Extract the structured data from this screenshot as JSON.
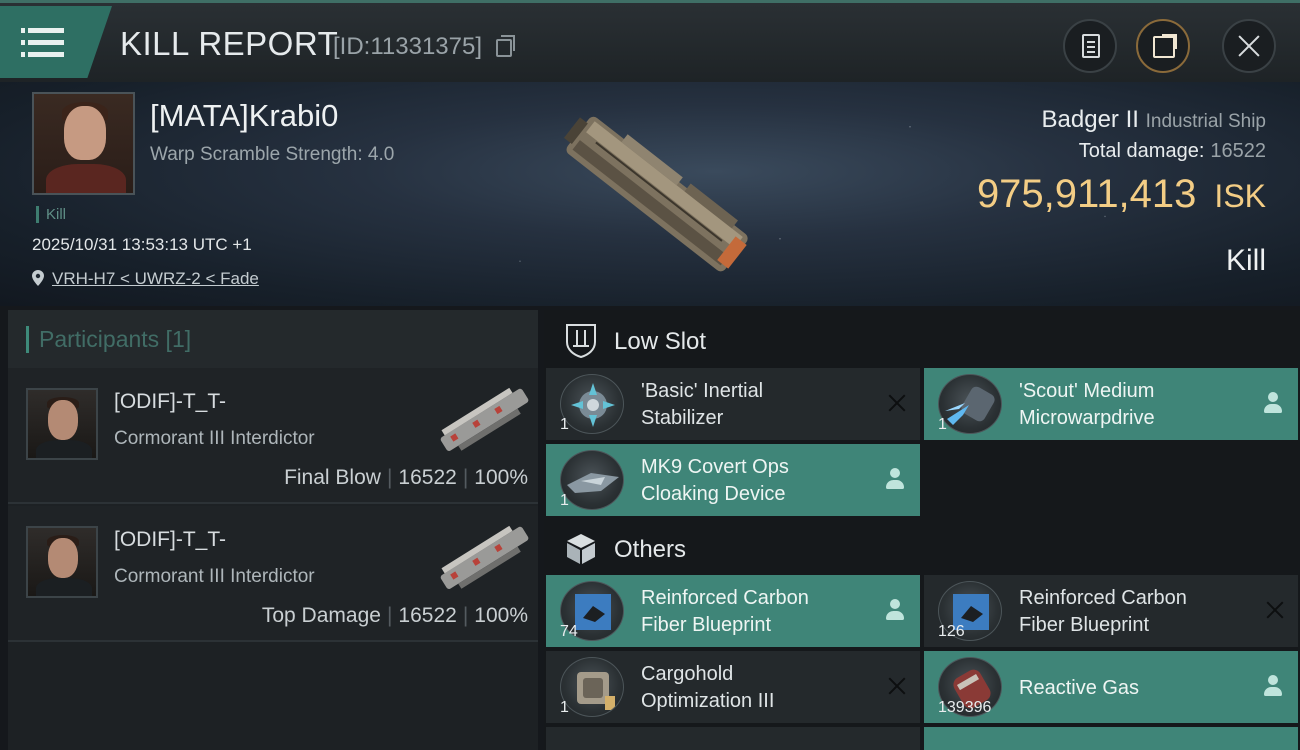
{
  "header": {
    "title": "KILL REPORT",
    "report_id": "[ID:11331375]"
  },
  "victim": {
    "name": "[MATA]Krabi0",
    "warp_scramble": "Warp Scramble Strength: 4.0",
    "tag": "Kill",
    "datetime": "2025/10/31 13:53:13 UTC +1",
    "location": "VRH-H7 < UWRZ-2 < Fade",
    "ship_name": "Badger II",
    "ship_class": "Industrial Ship",
    "total_damage_label": "Total damage:",
    "total_damage_value": "16522",
    "isk_value": "975,911,413",
    "isk_unit": "ISK",
    "result": "Kill"
  },
  "participants": {
    "label": "Participants [1]",
    "rows": [
      {
        "name": "[ODIF]-T_T-",
        "ship": "Cormorant III Interdictor",
        "role": "Final Blow",
        "damage": "16522",
        "percent": "100%"
      },
      {
        "name": "[ODIF]-T_T-",
        "ship": "Cormorant III Interdictor",
        "role": "Top Damage",
        "damage": "16522",
        "percent": "100%"
      }
    ]
  },
  "sections": {
    "low_slot": "Low Slot",
    "others": "Others"
  },
  "items": {
    "low": [
      {
        "name_line1": "'Basic' Inertial",
        "name_line2": "Stabilizer",
        "qty": "1",
        "status": "destroyed"
      },
      {
        "name_line1": "'Scout' Medium",
        "name_line2": "Microwarpdrive",
        "qty": "1",
        "status": "dropped"
      },
      {
        "name_line1": "MK9 Covert Ops",
        "name_line2": "Cloaking Device",
        "qty": "1",
        "status": "dropped"
      }
    ],
    "others": [
      {
        "name_line1": "Reinforced Carbon",
        "name_line2": "Fiber Blueprint",
        "qty": "74",
        "status": "dropped"
      },
      {
        "name_line1": "Reinforced Carbon",
        "name_line2": "Fiber Blueprint",
        "qty": "126",
        "status": "destroyed"
      },
      {
        "name_line1": "Cargohold",
        "name_line2": "Optimization III",
        "qty": "1",
        "status": "destroyed"
      },
      {
        "name_line1": "Reactive Gas",
        "name_line2": "",
        "qty": "139396",
        "status": "dropped"
      }
    ]
  },
  "colors": {
    "accent_teal": "#3f8578",
    "isk_gold": "#f3cd85",
    "background": "#15181c"
  },
  "icons": [
    "menu-icon",
    "copy-icon",
    "clipboard-icon",
    "share-icon",
    "close-icon",
    "location-pin-icon",
    "low-slot-icon",
    "cargo-box-icon",
    "destroyed-x-icon",
    "dropped-person-icon"
  ]
}
